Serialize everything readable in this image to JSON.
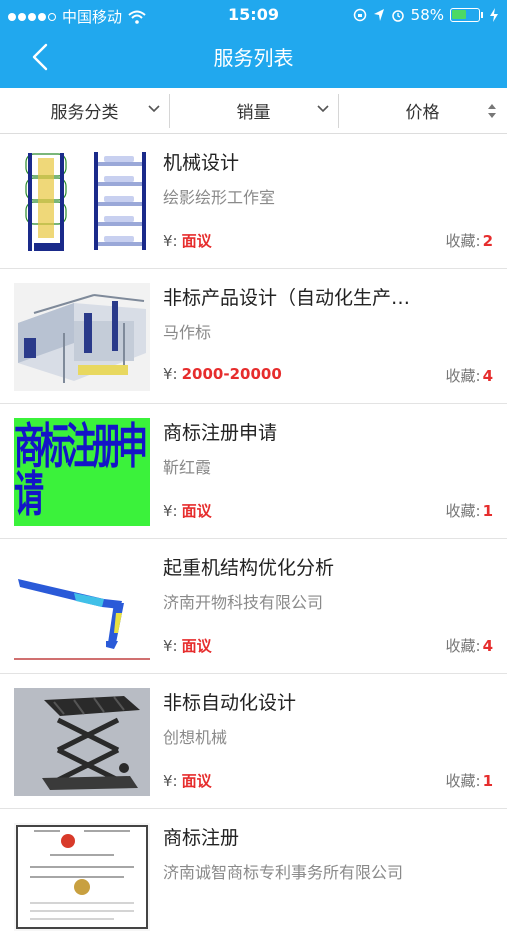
{
  "status_bar": {
    "carrier": "中国移动",
    "time": "15:09",
    "battery_text": "58%",
    "battery_level": 0.58
  },
  "nav": {
    "title": "服务列表",
    "back_icon": "chevron-left-icon"
  },
  "filters": [
    {
      "label": "服务分类",
      "icon": "chevron-down-icon"
    },
    {
      "label": "销量",
      "icon": "chevron-down-icon"
    },
    {
      "label": "价格",
      "icon": "sort-icon"
    }
  ],
  "list_labels": {
    "price_prefix": "¥:",
    "fav_prefix": "收藏:"
  },
  "items": [
    {
      "title": "机械设计",
      "provider": "绘影绘形工作室",
      "price": "面议",
      "favorites": "2"
    },
    {
      "title": "非标产品设计（自动化生产…",
      "provider": "马作标",
      "price": "2000-20000",
      "favorites": "4"
    },
    {
      "title": "商标注册申请",
      "provider": "靳红霞",
      "price": "面议",
      "favorites": "1",
      "thumb_text": "商标注册申请"
    },
    {
      "title": "起重机结构优化分析",
      "provider": "济南开物科技有限公司",
      "price": "面议",
      "favorites": "4"
    },
    {
      "title": "非标自动化设计",
      "provider": "创想机械",
      "price": "面议",
      "favorites": "1"
    },
    {
      "title": "商标注册",
      "provider": "济南诚智商标专利事务所有限公司",
      "price": "",
      "favorites": ""
    }
  ],
  "colors": {
    "header": "#21a8ee",
    "accent_red": "#e62d2d",
    "thumb_green": "#3bf23b",
    "thumb_text_blue": "#1414c8"
  }
}
